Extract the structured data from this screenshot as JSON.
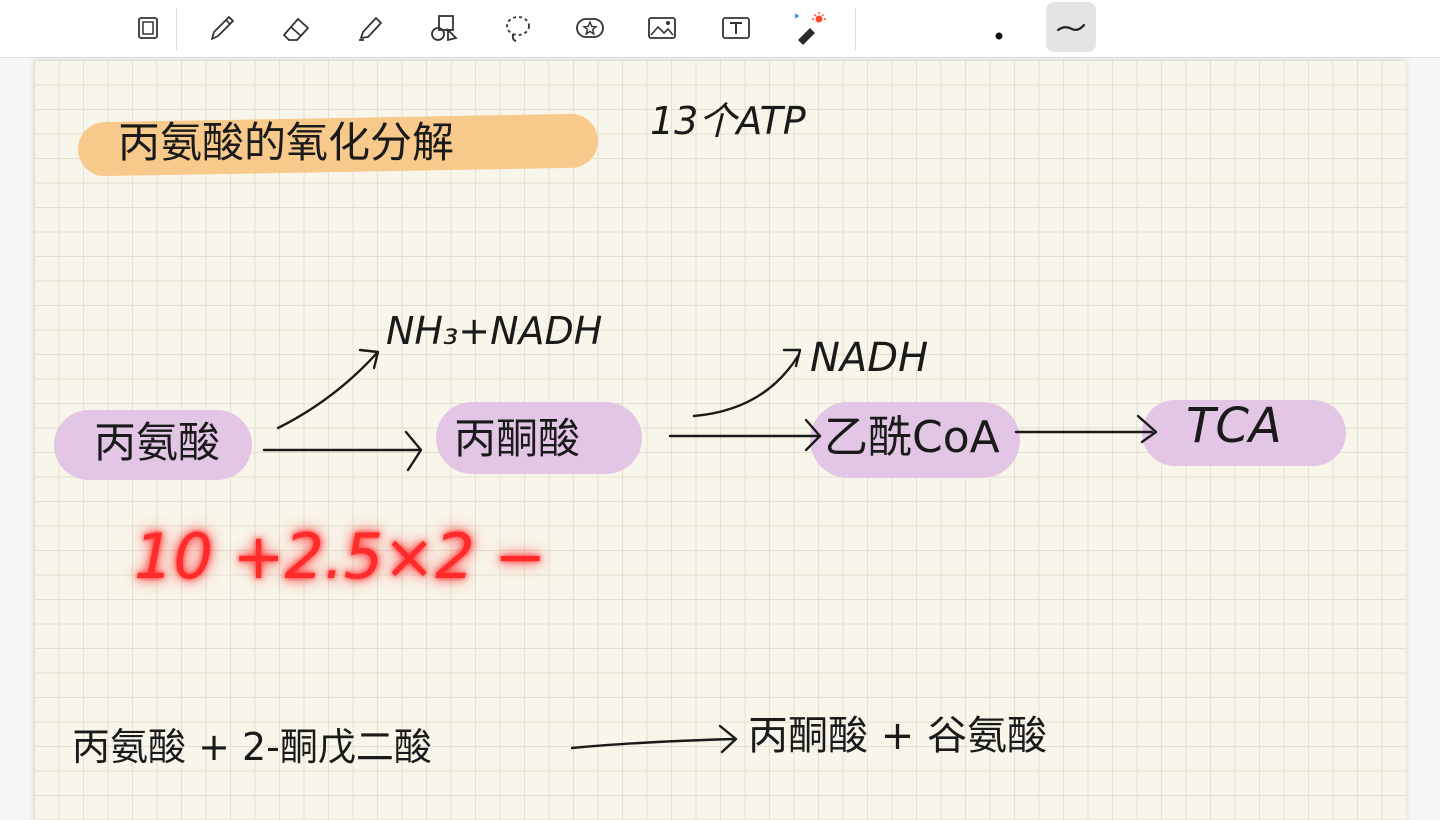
{
  "toolbar": {
    "tools": [
      {
        "name": "page-layout-icon"
      },
      {
        "name": "pen-icon"
      },
      {
        "name": "eraser-icon"
      },
      {
        "name": "highlighter-icon"
      },
      {
        "name": "shapes-icon"
      },
      {
        "name": "lasso-icon"
      },
      {
        "name": "sticker-icon"
      },
      {
        "name": "image-icon"
      },
      {
        "name": "text-icon"
      },
      {
        "name": "laser-pointer-icon"
      },
      {
        "name": "pen-size-dot-icon"
      },
      {
        "name": "stroke-style-icon"
      }
    ]
  },
  "colors": {
    "orange_highlight": "#f7c98a",
    "purple_highlight": "#e3c6e6",
    "ink": "#1a1a1a",
    "red_ink": "#ff2a2a"
  },
  "notes": {
    "title": "丙氨酸的氧化分解",
    "atp": "13个ATP",
    "reaction1": {
      "start": "丙氨酸",
      "byproduct1": "NH₃+NADH",
      "middle": "丙酮酸",
      "byproduct2": "NADH",
      "product": "乙酰CoA",
      "end": "TCA"
    },
    "calc": "10 +2.5×2 −",
    "reaction2": {
      "left": "丙氨酸 + 2-酮戊二酸",
      "right": "丙酮酸 + 谷氨酸"
    }
  }
}
